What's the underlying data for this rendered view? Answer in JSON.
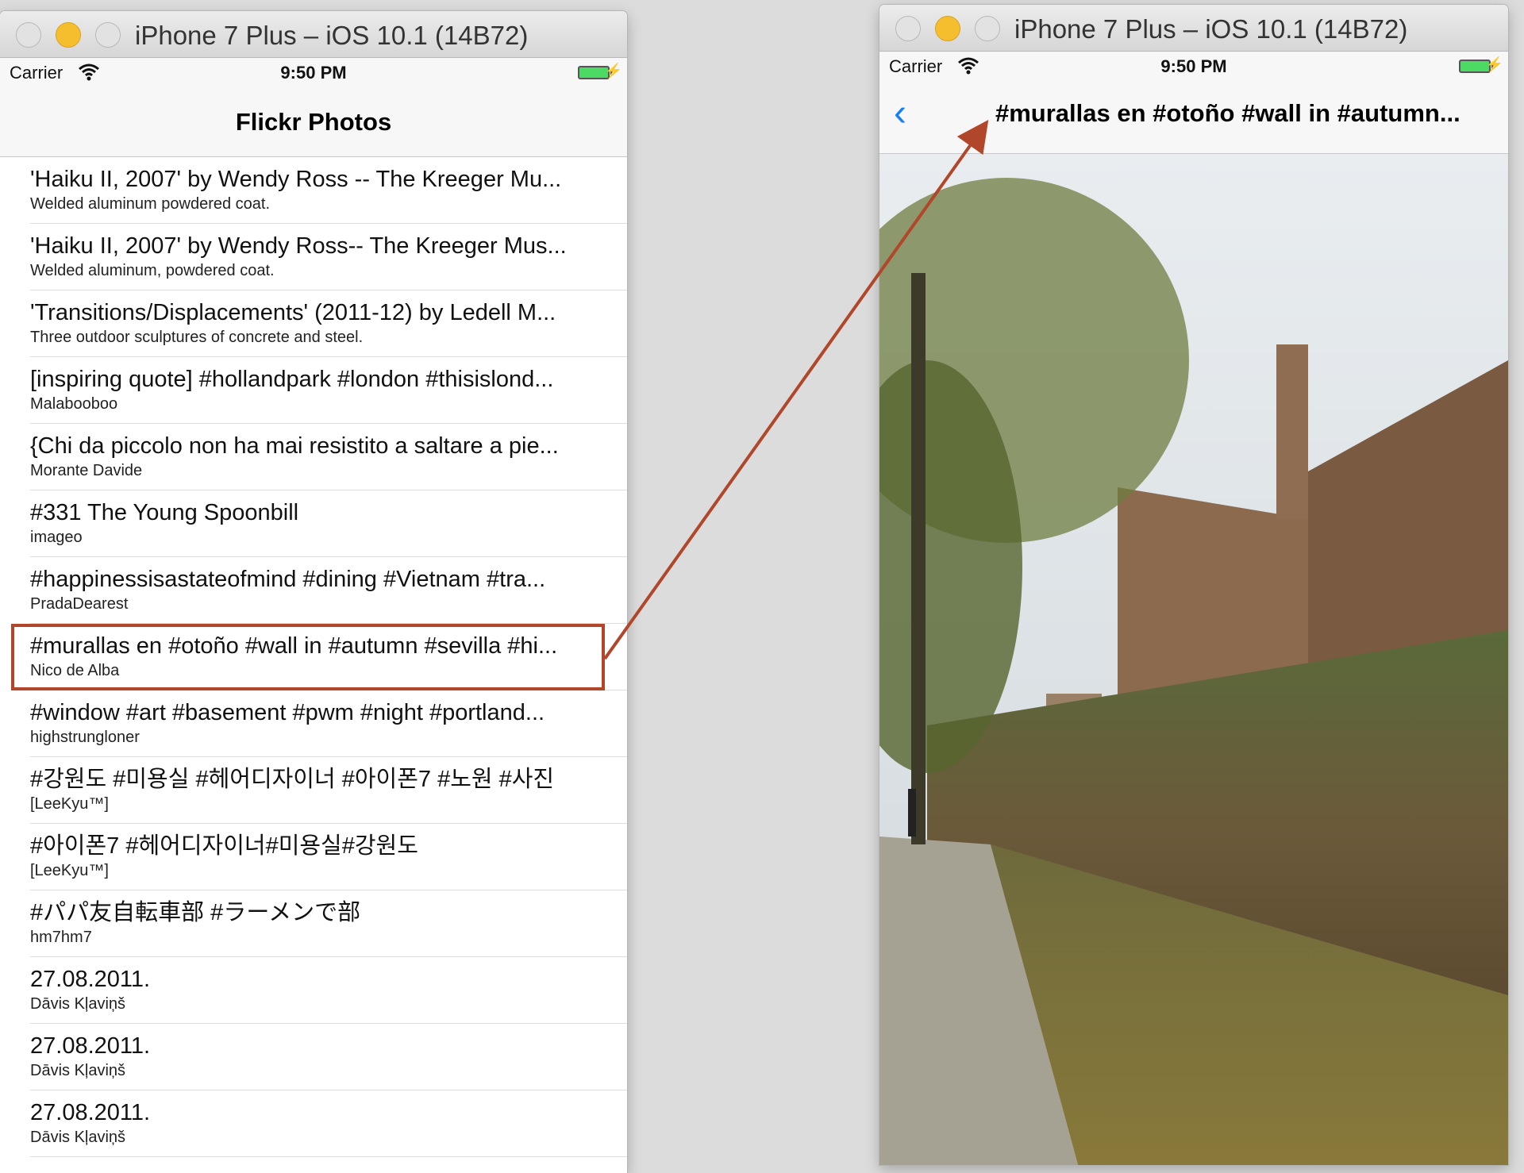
{
  "left_window": {
    "title": "iPhone 7 Plus – iOS 10.1 (14B72)",
    "status": {
      "carrier": "Carrier",
      "time": "9:50 PM"
    },
    "nav_title": "Flickr Photos",
    "rows": [
      {
        "title": "'Haiku II, 2007' by Wendy Ross -- The Kreeger Mu...",
        "subtitle": "Welded aluminum powdered coat."
      },
      {
        "title": "'Haiku II, 2007' by Wendy Ross-- The Kreeger Mus...",
        "subtitle": "Welded aluminum, powdered coat."
      },
      {
        "title": "'Transitions/Displacements' (2011-12) by Ledell M...",
        "subtitle": "Three outdoor sculptures of concrete and steel."
      },
      {
        "title": "[inspiring quote] #hollandpark #london #thisislond...",
        "subtitle": "Malabooboo"
      },
      {
        "title": "{Chi da piccolo non ha mai resistito a saltare a pie...",
        "subtitle": "Morante Davide"
      },
      {
        "title": "#331 The Young Spoonbill",
        "subtitle": "imageo"
      },
      {
        "title": "#happinessisastateofmind  #dining #Vietnam #tra...",
        "subtitle": "PradaDearest"
      },
      {
        "title": "#murallas en #otoño #wall in #autumn #sevilla #hi...",
        "subtitle": "Nico de Alba"
      },
      {
        "title": "#window #art #basement #pwm #night #portland...",
        "subtitle": "highstrungloner"
      },
      {
        "title": "#강원도 #미용실 #헤어디자이너 #아이폰7 #노원 #사진",
        "subtitle": "[LeeKyu™]"
      },
      {
        "title": "#아이폰7 #헤어디자이너#미용실#강원도",
        "subtitle": "[LeeKyu™]"
      },
      {
        "title": "#パパ友自転車部 #ラーメンで部",
        "subtitle": "hm7hm7"
      },
      {
        "title": "27.08.2011.",
        "subtitle": "Dāvis Kļaviņš"
      },
      {
        "title": "27.08.2011.",
        "subtitle": "Dāvis Kļaviņš"
      },
      {
        "title": "27.08.2011.",
        "subtitle": "Dāvis Kļaviņš"
      }
    ]
  },
  "right_window": {
    "title": "iPhone 7 Plus – iOS 10.1 (14B72)",
    "status": {
      "carrier": "Carrier",
      "time": "9:50 PM"
    },
    "nav_title": "#murallas en #otoño #wall in #autumn...",
    "back_icon": "chevron-left-icon"
  },
  "colors": {
    "highlight": "#b1472a",
    "ios_blue": "#147efb",
    "battery": "#4cd964"
  }
}
